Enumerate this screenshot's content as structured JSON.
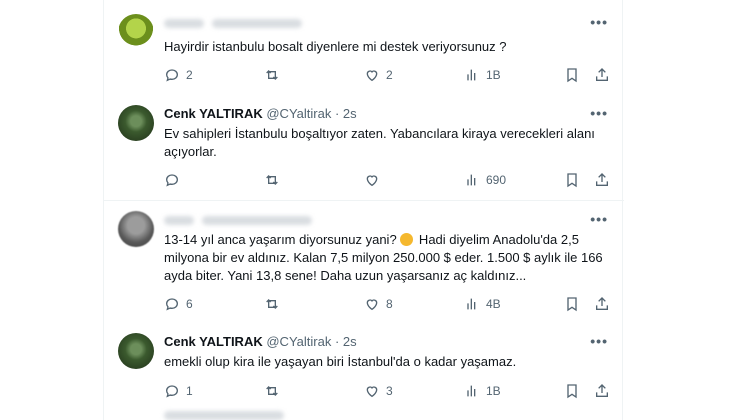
{
  "tweets": [
    {
      "name": "",
      "handle": "",
      "time": "",
      "text": "Hayirdir istanbulu bosalt diyenlere mi destek veriyorsunuz ?",
      "replies": "2",
      "retweets": "",
      "likes": "2",
      "views": "1B"
    },
    {
      "name": "Cenk YALTIRAK",
      "handle": "@CYaltirak",
      "time": "· 2s",
      "text": "Ev sahipleri İstanbulu boşaltıyor zaten.  Yabancılara kiraya verecekleri alanı açıyorlar.",
      "replies": "",
      "retweets": "",
      "likes": "",
      "views": "690"
    },
    {
      "name": "",
      "handle": "",
      "time": "",
      "text_before": "13-14 yıl anca yaşarım diyorsunuz yani?",
      "emoji": "thinking-face",
      "text_after": " Hadi diyelim Anadolu'da 2,5 milyona bir ev aldınız. Kalan 7,5 milyon 250.000 $ eder. 1.500 $ aylık ile 166 ayda biter. Yani 13,8 sene! Daha uzun yaşarsanız aç kaldınız...",
      "replies": "6",
      "retweets": "",
      "likes": "8",
      "views": "4B"
    },
    {
      "name": "Cenk YALTIRAK",
      "handle": "@CYaltirak",
      "time": "· 2s",
      "text": "emekli olup kira ile yaşayan biri İstanbul'da o kadar yaşamaz.",
      "replies": "1",
      "retweets": "",
      "likes": "3",
      "views": "1B"
    }
  ],
  "icons": {
    "reply": "reply-icon",
    "retweet": "retweet-icon",
    "like": "heart-icon",
    "views": "views-icon",
    "bookmark": "bookmark-icon",
    "share": "share-icon",
    "more": "more-icon"
  },
  "colors": {
    "text": "#0f1419",
    "muted": "#536471",
    "divider": "#eff3f4"
  }
}
